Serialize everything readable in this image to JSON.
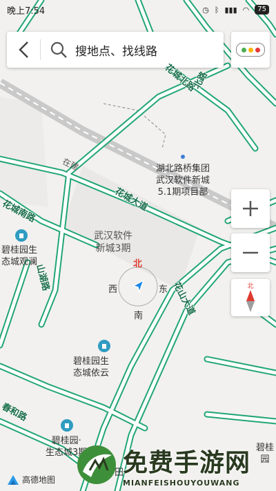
{
  "status_bar": {
    "time": "晚上7:54",
    "battery": "75"
  },
  "search": {
    "placeholder": "搜地点、找线路"
  },
  "map": {
    "labels": {
      "hubei_group": "湖北路桥集团\n武汉软件新城\n5.1期项目部",
      "software_city": "武汉软件\n新城3期",
      "biguiyuan_guanlan": "碧桂园生\n态城观澜",
      "biguiyuan_yiyun": "碧桂园生\n态城依云",
      "biguiyuan_3": "碧桂园·\n生态城3期",
      "biguiyuan_right": "碧桂园",
      "tian": "田"
    },
    "roads": {
      "huacheng_blvd": "花城大道",
      "huacheng_south": "花城南路",
      "huashan_blvd": "花山大道",
      "shanhu_rd": "山湖路",
      "chunhe_rd": "春和路",
      "huacheng_north": "花城北路",
      "zaiqiao": "在建",
      "bei_rd": "北路"
    },
    "compass_rose": {
      "north": "北",
      "south": "南",
      "east": "东",
      "west": "西"
    }
  },
  "controls": {
    "zoom_in": "+",
    "zoom_out": "−",
    "compass_north": "北"
  },
  "brand": {
    "logo_text": "高德地图"
  },
  "watermark": {
    "title": "免费手游网",
    "subtitle": "MIANFEISHOUYOUWANG"
  },
  "colors": {
    "road_green": "#21a674",
    "map_bg": "#f2f1ef",
    "accent_blue": "#1e88e5",
    "north_red": "#e03a2e"
  }
}
